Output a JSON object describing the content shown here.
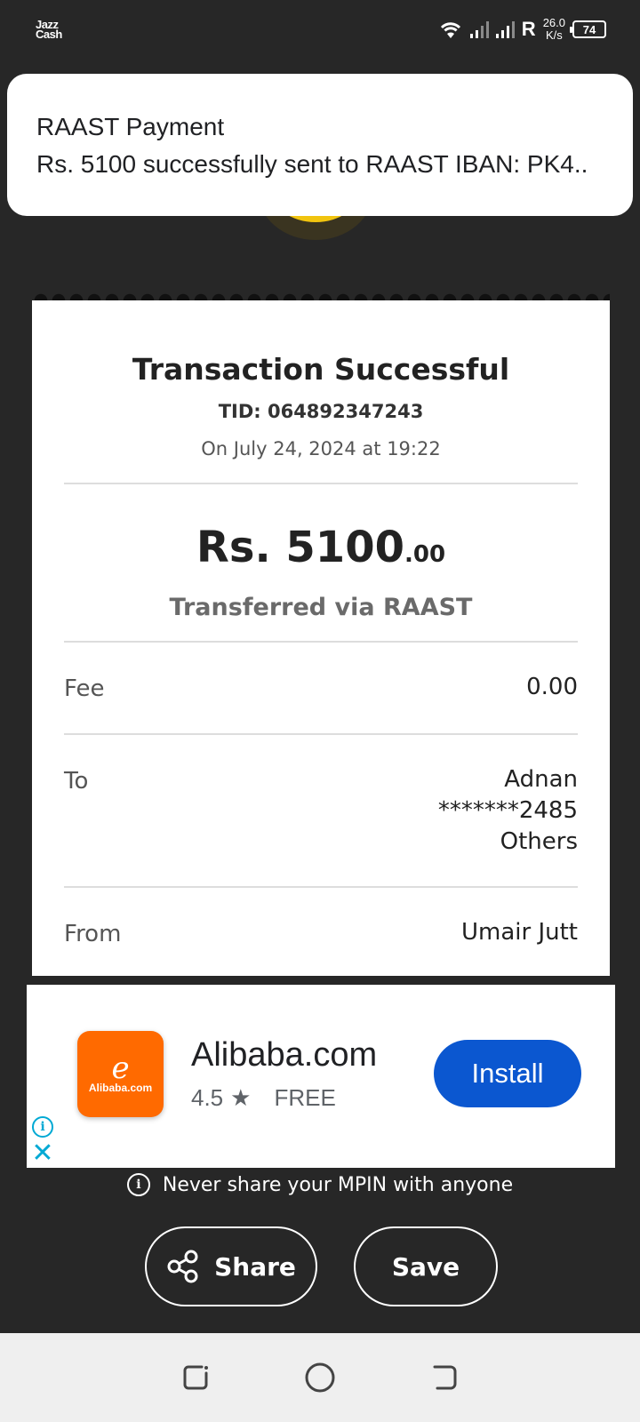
{
  "status_bar": {
    "app_logo_line1": "Jazz",
    "app_logo_line2": "Cash",
    "network_letter": "R",
    "speed_value": "26.0",
    "speed_unit": "K/s",
    "battery": "74"
  },
  "notification": {
    "title": "RAAST Payment",
    "body": "Rs. 5100 successfully sent to RAAST IBAN: PK4.."
  },
  "receipt": {
    "title": "Transaction Successful",
    "tid": "TID: 064892347243",
    "date": "On July 24, 2024 at 19:22",
    "amount_main": "Rs. 5100",
    "amount_decimals": ".00",
    "via": "Transferred via RAAST",
    "fee_label": "Fee",
    "fee_value": "0.00",
    "to_label": "To",
    "to_name": "Adnan",
    "to_account": "*******2485",
    "to_bank": "Others",
    "from_label": "From",
    "from_name": "Umair Jutt"
  },
  "ad": {
    "app_name": "Alibaba.com",
    "icon_text": "Alibaba.com",
    "rating": "4.5",
    "price": "FREE",
    "install_label": "Install"
  },
  "footer": {
    "mpin_note": "Never share your MPIN with anyone",
    "share_label": "Share",
    "save_label": "Save"
  }
}
